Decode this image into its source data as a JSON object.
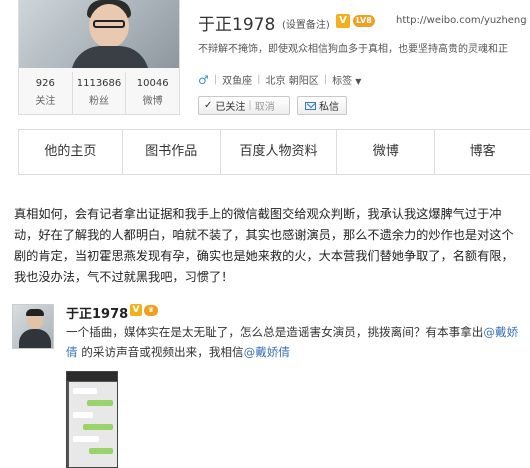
{
  "profile": {
    "name": "于正1978",
    "remark_link": "(设置备注)",
    "verified_badge": "V",
    "vip_badge": "LV8",
    "url": "http://weibo.com/yuzheng",
    "bio": "不辩解不掩饰，即使观众相信狗血多于真相，也要坚持高贵的灵魂和正",
    "gender_icon": "male-icon",
    "zodiac": "双鱼座",
    "location": "北京 朝阳区",
    "tags_label": "标签",
    "stats": [
      {
        "value": "926",
        "label": "关注"
      },
      {
        "value": "1113686",
        "label": "粉丝"
      },
      {
        "value": "10046",
        "label": "微博"
      }
    ],
    "followed_label": "已关注",
    "cancel_label": "取消",
    "message_label": "私信"
  },
  "tabs": [
    {
      "label": "他的主页"
    },
    {
      "label": "图书作品"
    },
    {
      "label": "百度人物资料"
    },
    {
      "label": "微博"
    },
    {
      "label": "博客"
    }
  ],
  "article": {
    "text": "真相如何，会有记者拿出证据和我手上的微信截图交给观众判断，我承认我这爆脾气过于冲动，好在了解我的人都明白，咱就不装了，其实也感谢演员，那么不遗余力的炒作也是对这个剧的肯定，当初霍思燕发现有孕，确实也是她来救的火，大本营我们替她争取了，名额有限，我也没办法，气不过就黑我吧，习惯了！"
  },
  "post": {
    "author": "于正1978",
    "verified_badge": "V",
    "text_before": "一个插曲，媒体实在是太无耻了，怎么总是造谣害女演员，挑拨离间？有本事拿出",
    "mention_1": "@戴娇倩",
    "text_middle": " 的采访声音或视频出来，我相信",
    "mention_2": "@戴娇倩"
  }
}
